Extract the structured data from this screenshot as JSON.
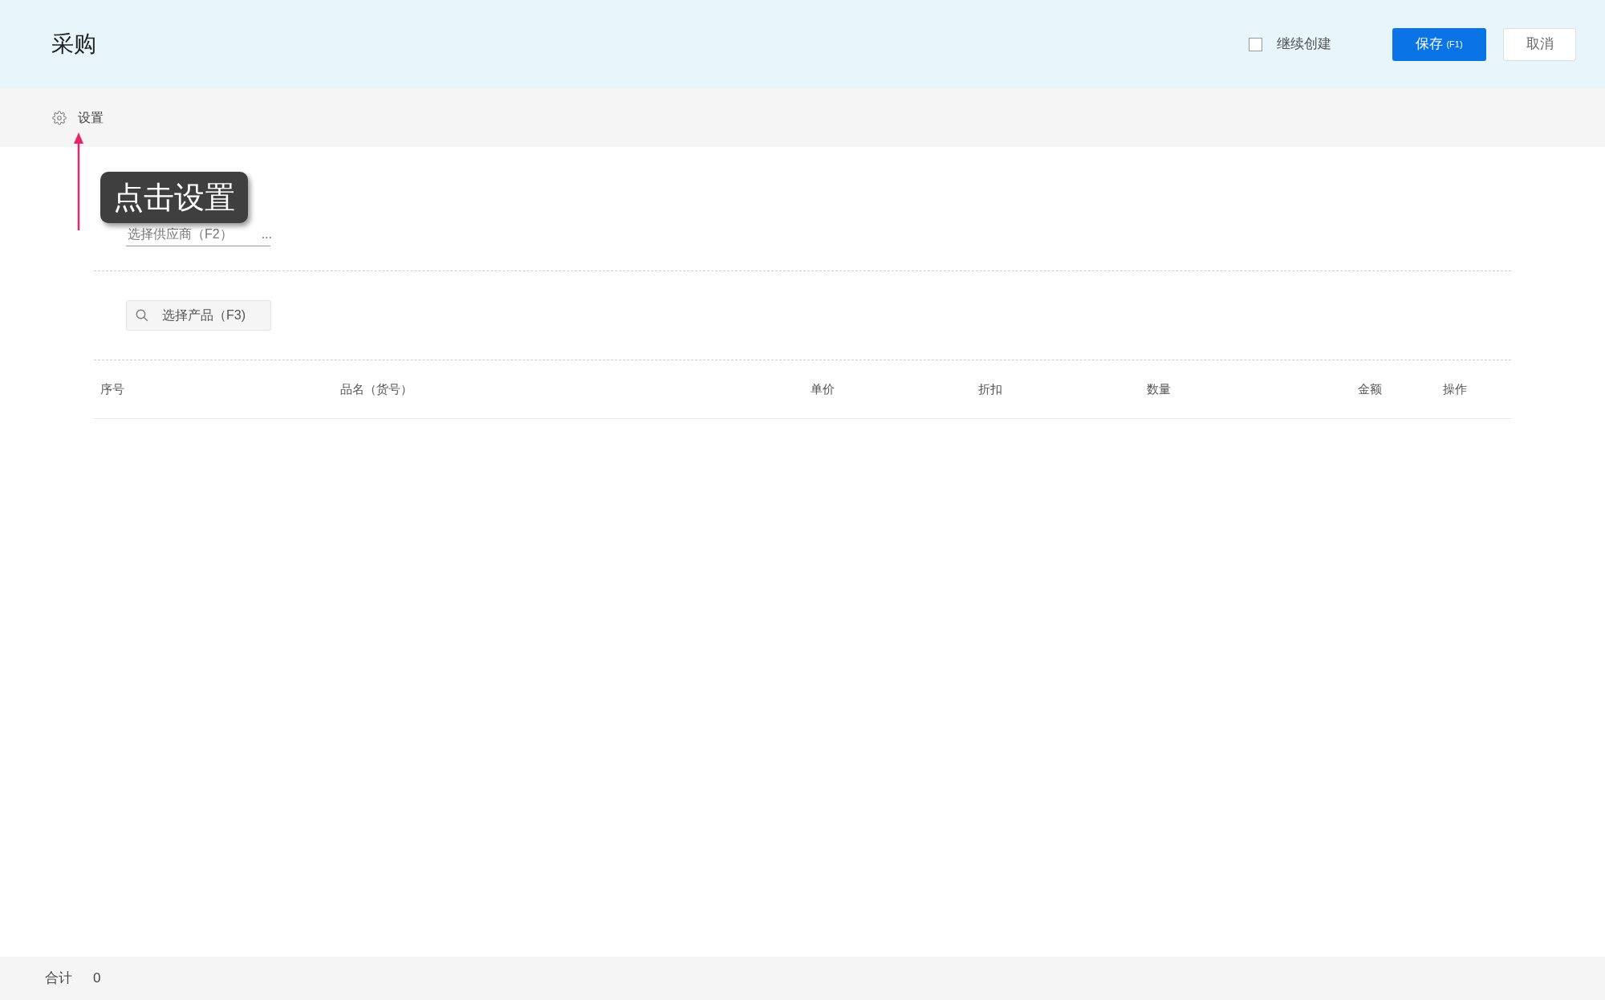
{
  "header": {
    "title": "采购",
    "continue_create": {
      "label": "继续创建",
      "checked": false
    },
    "buttons": [
      {
        "kind": "primary",
        "label": "保存",
        "shortcut": "(F1)"
      },
      {
        "kind": "secondary",
        "label": "取消"
      }
    ]
  },
  "settings_bar": {
    "label": "设置"
  },
  "annotation": {
    "text": "点击设置"
  },
  "supplier_field": {
    "placeholder": "选择供应商（F2）",
    "more": "..."
  },
  "product_search": {
    "placeholder": "选择产品（F3)"
  },
  "table": {
    "columns": [
      "序号",
      "品名（货号）",
      "单价",
      "折扣",
      "数量",
      "金额",
      "操作"
    ]
  },
  "footer": {
    "label": "合计",
    "value": "0"
  }
}
